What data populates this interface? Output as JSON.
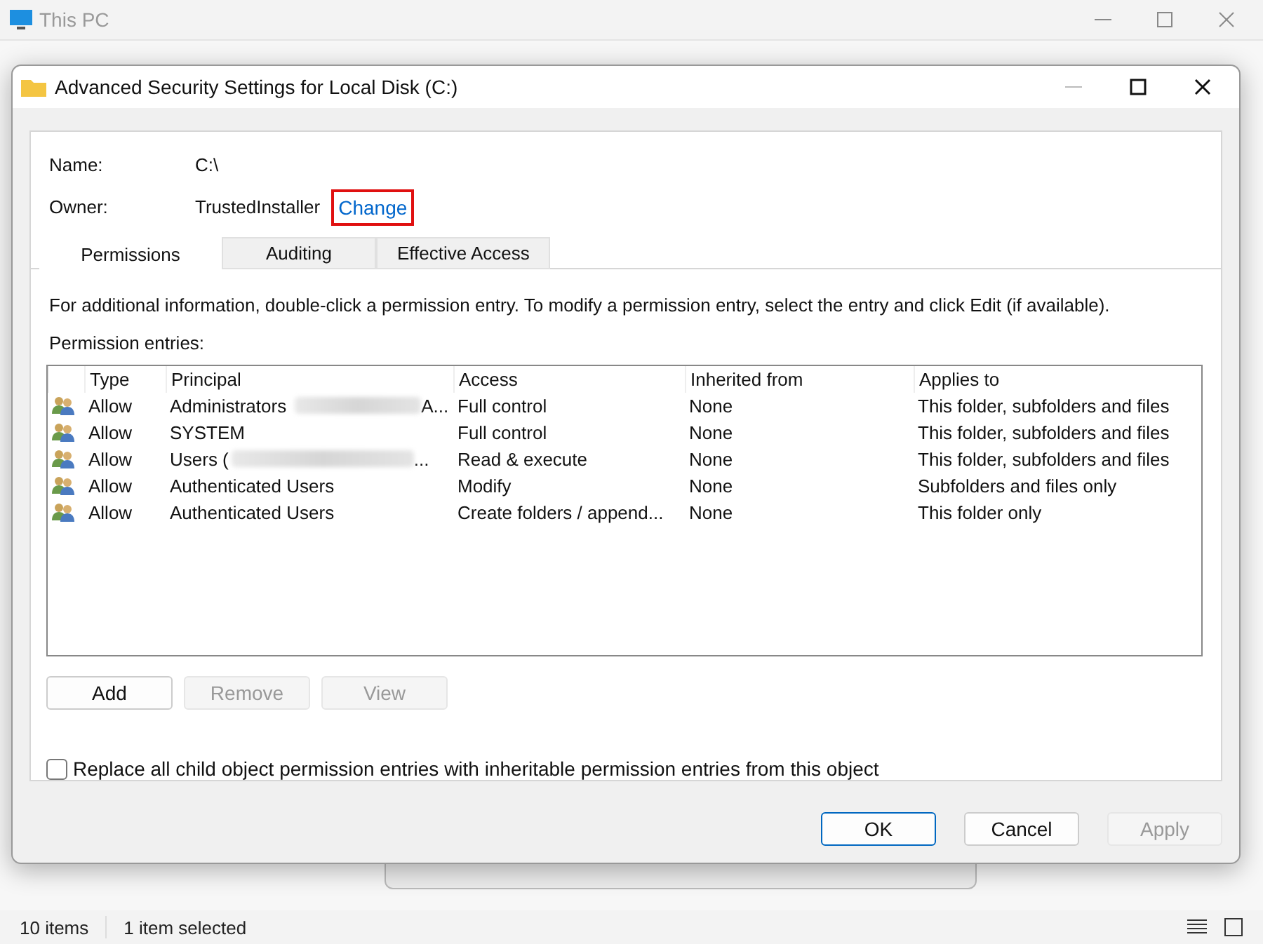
{
  "explorer": {
    "title": "This PC",
    "status_bar": {
      "count": "10 items",
      "selection": "1 item selected"
    }
  },
  "dialog": {
    "title": "Advanced Security Settings for Local Disk (C:)",
    "name_label": "Name:",
    "name_value": "C:\\",
    "owner_label": "Owner:",
    "owner_value": "TrustedInstaller",
    "change_link": "Change",
    "tabs": [
      {
        "label": "Permissions",
        "selected": true
      },
      {
        "label": "Auditing",
        "selected": false
      },
      {
        "label": "Effective Access",
        "selected": false
      }
    ],
    "info": "For additional information, double-click a permission entry. To modify a permission entry, select the entry and click Edit (if available).",
    "entries_label": "Permission entries:",
    "columns": [
      "Type",
      "Principal",
      "Access",
      "Inherited from",
      "Applies to"
    ],
    "rows": [
      {
        "type": "Allow",
        "principal": "Administrators",
        "tail": "A...",
        "access": "Full control",
        "inherited": "None",
        "applies": "This folder, subfolders and files"
      },
      {
        "type": "Allow",
        "principal": "SYSTEM",
        "access": "Full control",
        "inherited": "None",
        "applies": "This folder, subfolders and files"
      },
      {
        "type": "Allow",
        "principal": "Users (",
        "tail": "...",
        "access": "Read & execute",
        "inherited": "None",
        "applies": "This folder, subfolders and files"
      },
      {
        "type": "Allow",
        "principal": "Authenticated Users",
        "access": "Modify",
        "inherited": "None",
        "applies": "Subfolders and files only"
      },
      {
        "type": "Allow",
        "principal": "Authenticated Users",
        "access": "Create folders / append...",
        "inherited": "None",
        "applies": "This folder only"
      }
    ],
    "row_buttons": [
      {
        "label": "Add",
        "disabled": false
      },
      {
        "label": "Remove",
        "disabled": true
      },
      {
        "label": "View",
        "disabled": true
      }
    ],
    "replace_checkbox": {
      "label": "Replace all child object permission entries with inheritable permission entries from this object",
      "checked": false
    },
    "footer_buttons": [
      {
        "label": "OK",
        "disabled": false,
        "default": true
      },
      {
        "label": "Cancel",
        "disabled": false,
        "default": false
      },
      {
        "label": "Apply",
        "disabled": true,
        "default": false
      }
    ]
  }
}
